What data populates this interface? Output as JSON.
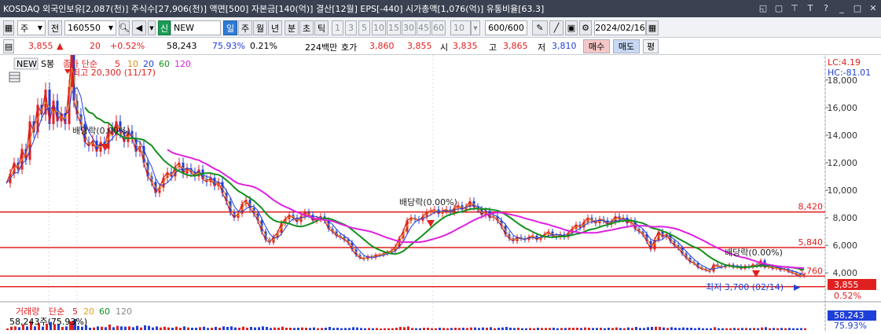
{
  "window": {
    "title": "KOSDAQ  외국인보유[2,087(천)]  주식수[27,906(천)]  액면[500]  자본금[140(억)]  결산[12월]  EPS[-440]  시가총액[1,076(억)]  유통비율[63.3]",
    "buttons": [
      "layout-icon",
      "copy-icon",
      "pin-icon",
      "font-icon",
      "help-icon",
      "minimize-icon",
      "maximize-icon",
      "close-icon"
    ]
  },
  "toolbar": {
    "market": "주",
    "all_label": "전",
    "code": "160550",
    "new_badge": "신",
    "new_label": "NEW",
    "periods": [
      "일",
      "주",
      "월",
      "년",
      "분",
      "초",
      "틱"
    ],
    "selected_period": "일",
    "intervals": [
      "1",
      "3",
      "5",
      "10",
      "15",
      "30",
      "45",
      "60",
      "10"
    ],
    "count": "600/600",
    "date": "2024/02/16"
  },
  "quote": {
    "price": "3,855",
    "change_arrow": "▲",
    "change": "20",
    "change_pct": "+0.52%",
    "volume": "58,243",
    "volume_ratio": "75.93%",
    "turnover": "0.21%",
    "amount": "224백만",
    "ask_label": "호가",
    "ask1": "3,860",
    "ask2": "3,855",
    "open_label": "시",
    "open": "3,835",
    "high_label": "고",
    "high": "3,865",
    "low_label": "저",
    "low": "3,810",
    "buy_label": "매수",
    "sell_label": "매도",
    "eval_label": "평"
  },
  "legend": {
    "new_tag": "NEW",
    "sbong": "S봉",
    "ma_label": "종가 단순",
    "ma_periods": [
      "5",
      "10",
      "20",
      "60",
      "120"
    ],
    "ma_colors": [
      "#e0201f",
      "#e08a1a",
      "#1f3fd8",
      "#12901e",
      "#e020e0"
    ]
  },
  "chart_data": {
    "type": "line",
    "title": "",
    "y_ticks": [
      "18,000",
      "16,000",
      "14,000",
      "12,000",
      "10,000",
      "8,000",
      "6,000",
      "4,000"
    ],
    "ylim": [
      2700,
      19700
    ],
    "right_top_labels": [
      "LC:4.19",
      "HC:-81.01"
    ],
    "horizontal_lines": [
      {
        "value": 8420,
        "label": "8,420"
      },
      {
        "value": 5840,
        "label": "5,840"
      },
      {
        "value": 3760,
        "label": "3,760"
      },
      {
        "value": 3000,
        "label": ""
      }
    ],
    "current_price": {
      "value": 3855,
      "label": "3,855",
      "pct": "0.52%"
    },
    "annotations": [
      {
        "text": "최고 20,300 (11/17)",
        "value": 20300
      },
      {
        "text": "배당락(0.00%)",
        "position": "early"
      },
      {
        "text": "배당락(0.00%)",
        "position": "middle"
      },
      {
        "text": "배당락(0.00%)",
        "position": "late"
      },
      {
        "text": "최저 3,700 (02/14)",
        "value": 3700
      }
    ],
    "price_path": [
      [
        0,
        10500
      ],
      [
        5,
        11200
      ],
      [
        10,
        12000
      ],
      [
        15,
        11500
      ],
      [
        20,
        13000
      ],
      [
        25,
        12200
      ],
      [
        30,
        15000
      ],
      [
        35,
        14200
      ],
      [
        40,
        16200
      ],
      [
        45,
        15500
      ],
      [
        50,
        17300
      ],
      [
        55,
        14800
      ],
      [
        60,
        16500
      ],
      [
        65,
        15000
      ],
      [
        70,
        15600
      ],
      [
        75,
        14800
      ],
      [
        80,
        17500
      ],
      [
        83,
        20300
      ],
      [
        86,
        16500
      ],
      [
        90,
        15500
      ],
      [
        95,
        14800
      ],
      [
        100,
        13500
      ],
      [
        105,
        13200
      ],
      [
        110,
        13600
      ],
      [
        115,
        12800
      ],
      [
        120,
        13500
      ],
      [
        125,
        13000
      ],
      [
        130,
        14500
      ],
      [
        135,
        14000
      ],
      [
        140,
        15000
      ],
      [
        145,
        14200
      ],
      [
        150,
        13500
      ],
      [
        155,
        14300
      ],
      [
        160,
        13800
      ],
      [
        165,
        12800
      ],
      [
        170,
        13200
      ],
      [
        175,
        12000
      ],
      [
        180,
        11000
      ],
      [
        185,
        10600
      ],
      [
        190,
        9800
      ],
      [
        195,
        10200
      ],
      [
        200,
        10900
      ],
      [
        205,
        11300
      ],
      [
        210,
        11000
      ],
      [
        215,
        11700
      ],
      [
        220,
        12000
      ],
      [
        225,
        11200
      ],
      [
        230,
        11600
      ],
      [
        235,
        11300
      ],
      [
        240,
        11000
      ],
      [
        245,
        11500
      ],
      [
        250,
        10800
      ],
      [
        255,
        10600
      ],
      [
        260,
        10900
      ],
      [
        265,
        10300
      ],
      [
        270,
        10600
      ],
      [
        275,
        9800
      ],
      [
        280,
        9200
      ],
      [
        285,
        8400
      ],
      [
        290,
        8000
      ],
      [
        295,
        8300
      ],
      [
        300,
        9000
      ],
      [
        305,
        9300
      ],
      [
        310,
        8700
      ],
      [
        315,
        8300
      ],
      [
        320,
        7800
      ],
      [
        325,
        7000
      ],
      [
        330,
        6400
      ],
      [
        335,
        6200
      ],
      [
        340,
        6600
      ],
      [
        345,
        6900
      ],
      [
        350,
        7600
      ],
      [
        355,
        7900
      ],
      [
        360,
        8200
      ],
      [
        365,
        8000
      ],
      [
        370,
        7700
      ],
      [
        375,
        8100
      ],
      [
        380,
        8400
      ],
      [
        385,
        8200
      ],
      [
        390,
        7800
      ],
      [
        395,
        7900
      ],
      [
        400,
        8100
      ],
      [
        405,
        7800
      ],
      [
        410,
        7200
      ],
      [
        415,
        7000
      ],
      [
        420,
        6700
      ],
      [
        425,
        6600
      ],
      [
        430,
        6400
      ],
      [
        435,
        6200
      ],
      [
        440,
        5700
      ],
      [
        445,
        5300
      ],
      [
        450,
        5100
      ],
      [
        455,
        5000
      ],
      [
        460,
        5200
      ],
      [
        465,
        5100
      ],
      [
        470,
        5300
      ],
      [
        475,
        5300
      ],
      [
        480,
        5400
      ],
      [
        485,
        5500
      ],
      [
        490,
        5600
      ],
      [
        495,
        5900
      ],
      [
        500,
        6500
      ],
      [
        505,
        7000
      ],
      [
        510,
        7800
      ],
      [
        515,
        8000
      ],
      [
        520,
        7900
      ],
      [
        525,
        7800
      ],
      [
        530,
        8100
      ],
      [
        535,
        8400
      ],
      [
        540,
        8500
      ],
      [
        545,
        8600
      ],
      [
        550,
        8300
      ],
      [
        555,
        8500
      ],
      [
        560,
        8600
      ],
      [
        565,
        8400
      ],
      [
        570,
        8700
      ],
      [
        575,
        8900
      ],
      [
        580,
        8600
      ],
      [
        585,
        8800
      ],
      [
        590,
        9200
      ],
      [
        595,
        8800
      ],
      [
        600,
        8600
      ],
      [
        605,
        8200
      ],
      [
        610,
        8500
      ],
      [
        615,
        8000
      ],
      [
        620,
        8100
      ],
      [
        625,
        7800
      ],
      [
        630,
        7400
      ],
      [
        635,
        6800
      ],
      [
        640,
        6500
      ],
      [
        645,
        6300
      ],
      [
        650,
        6600
      ],
      [
        655,
        6500
      ],
      [
        660,
        6400
      ],
      [
        665,
        6600
      ],
      [
        670,
        6700
      ],
      [
        675,
        6400
      ],
      [
        680,
        6600
      ],
      [
        685,
        6800
      ],
      [
        690,
        7000
      ],
      [
        695,
        6700
      ],
      [
        700,
        6600
      ],
      [
        705,
        6800
      ],
      [
        710,
        6600
      ],
      [
        715,
        6900
      ],
      [
        720,
        7200
      ],
      [
        725,
        7500
      ],
      [
        730,
        7300
      ],
      [
        735,
        7700
      ],
      [
        740,
        8000
      ],
      [
        745,
        7800
      ],
      [
        750,
        7600
      ],
      [
        755,
        7900
      ],
      [
        760,
        7800
      ],
      [
        765,
        7500
      ],
      [
        770,
        7700
      ],
      [
        775,
        8100
      ],
      [
        780,
        7900
      ],
      [
        785,
        8000
      ],
      [
        790,
        7600
      ],
      [
        795,
        7800
      ],
      [
        800,
        7200
      ],
      [
        805,
        7000
      ],
      [
        810,
        6800
      ],
      [
        815,
        6300
      ],
      [
        820,
        5700
      ],
      [
        825,
        6400
      ],
      [
        830,
        7000
      ],
      [
        835,
        6600
      ],
      [
        840,
        6800
      ],
      [
        845,
        6300
      ],
      [
        850,
        6000
      ],
      [
        855,
        5800
      ],
      [
        860,
        5400
      ],
      [
        865,
        5100
      ],
      [
        870,
        4800
      ],
      [
        875,
        4700
      ],
      [
        880,
        4400
      ],
      [
        885,
        4300
      ],
      [
        890,
        4200
      ],
      [
        895,
        4100
      ],
      [
        900,
        4600
      ],
      [
        905,
        4500
      ],
      [
        910,
        4400
      ],
      [
        915,
        4500
      ],
      [
        920,
        4600
      ],
      [
        925,
        4400
      ],
      [
        930,
        4500
      ],
      [
        935,
        4300
      ],
      [
        940,
        4500
      ],
      [
        945,
        4400
      ],
      [
        950,
        4600
      ],
      [
        955,
        4500
      ],
      [
        960,
        4900
      ],
      [
        965,
        4400
      ],
      [
        970,
        4500
      ],
      [
        975,
        4300
      ],
      [
        980,
        4400
      ],
      [
        985,
        4200
      ],
      [
        990,
        4300
      ],
      [
        995,
        4100
      ],
      [
        1000,
        4000
      ],
      [
        1005,
        3900
      ],
      [
        1010,
        3760
      ],
      [
        1015,
        3855
      ]
    ],
    "ma_series": [
      {
        "name": "5",
        "color": "#e0201f",
        "smoothing": 5
      },
      {
        "name": "10",
        "color": "#e08a1a",
        "smoothing": 10
      },
      {
        "name": "20",
        "color": "#1f3fd8",
        "smoothing": 20
      },
      {
        "name": "60",
        "color": "#12901e",
        "smoothing": 60,
        "start": 100
      },
      {
        "name": "120",
        "color": "#e020e0",
        "smoothing": 120,
        "start": 205
      }
    ]
  },
  "volume_panel": {
    "label": "거래량",
    "ma_label": "단순",
    "ma_periods": [
      "5",
      "20",
      "60",
      "120"
    ],
    "ma_colors": [
      "#e0201f",
      "#e0a21a",
      "#12901e",
      "#888888"
    ],
    "value_text": "58,243주(75.93%)",
    "current": "58,243",
    "pct": "75.93%"
  }
}
